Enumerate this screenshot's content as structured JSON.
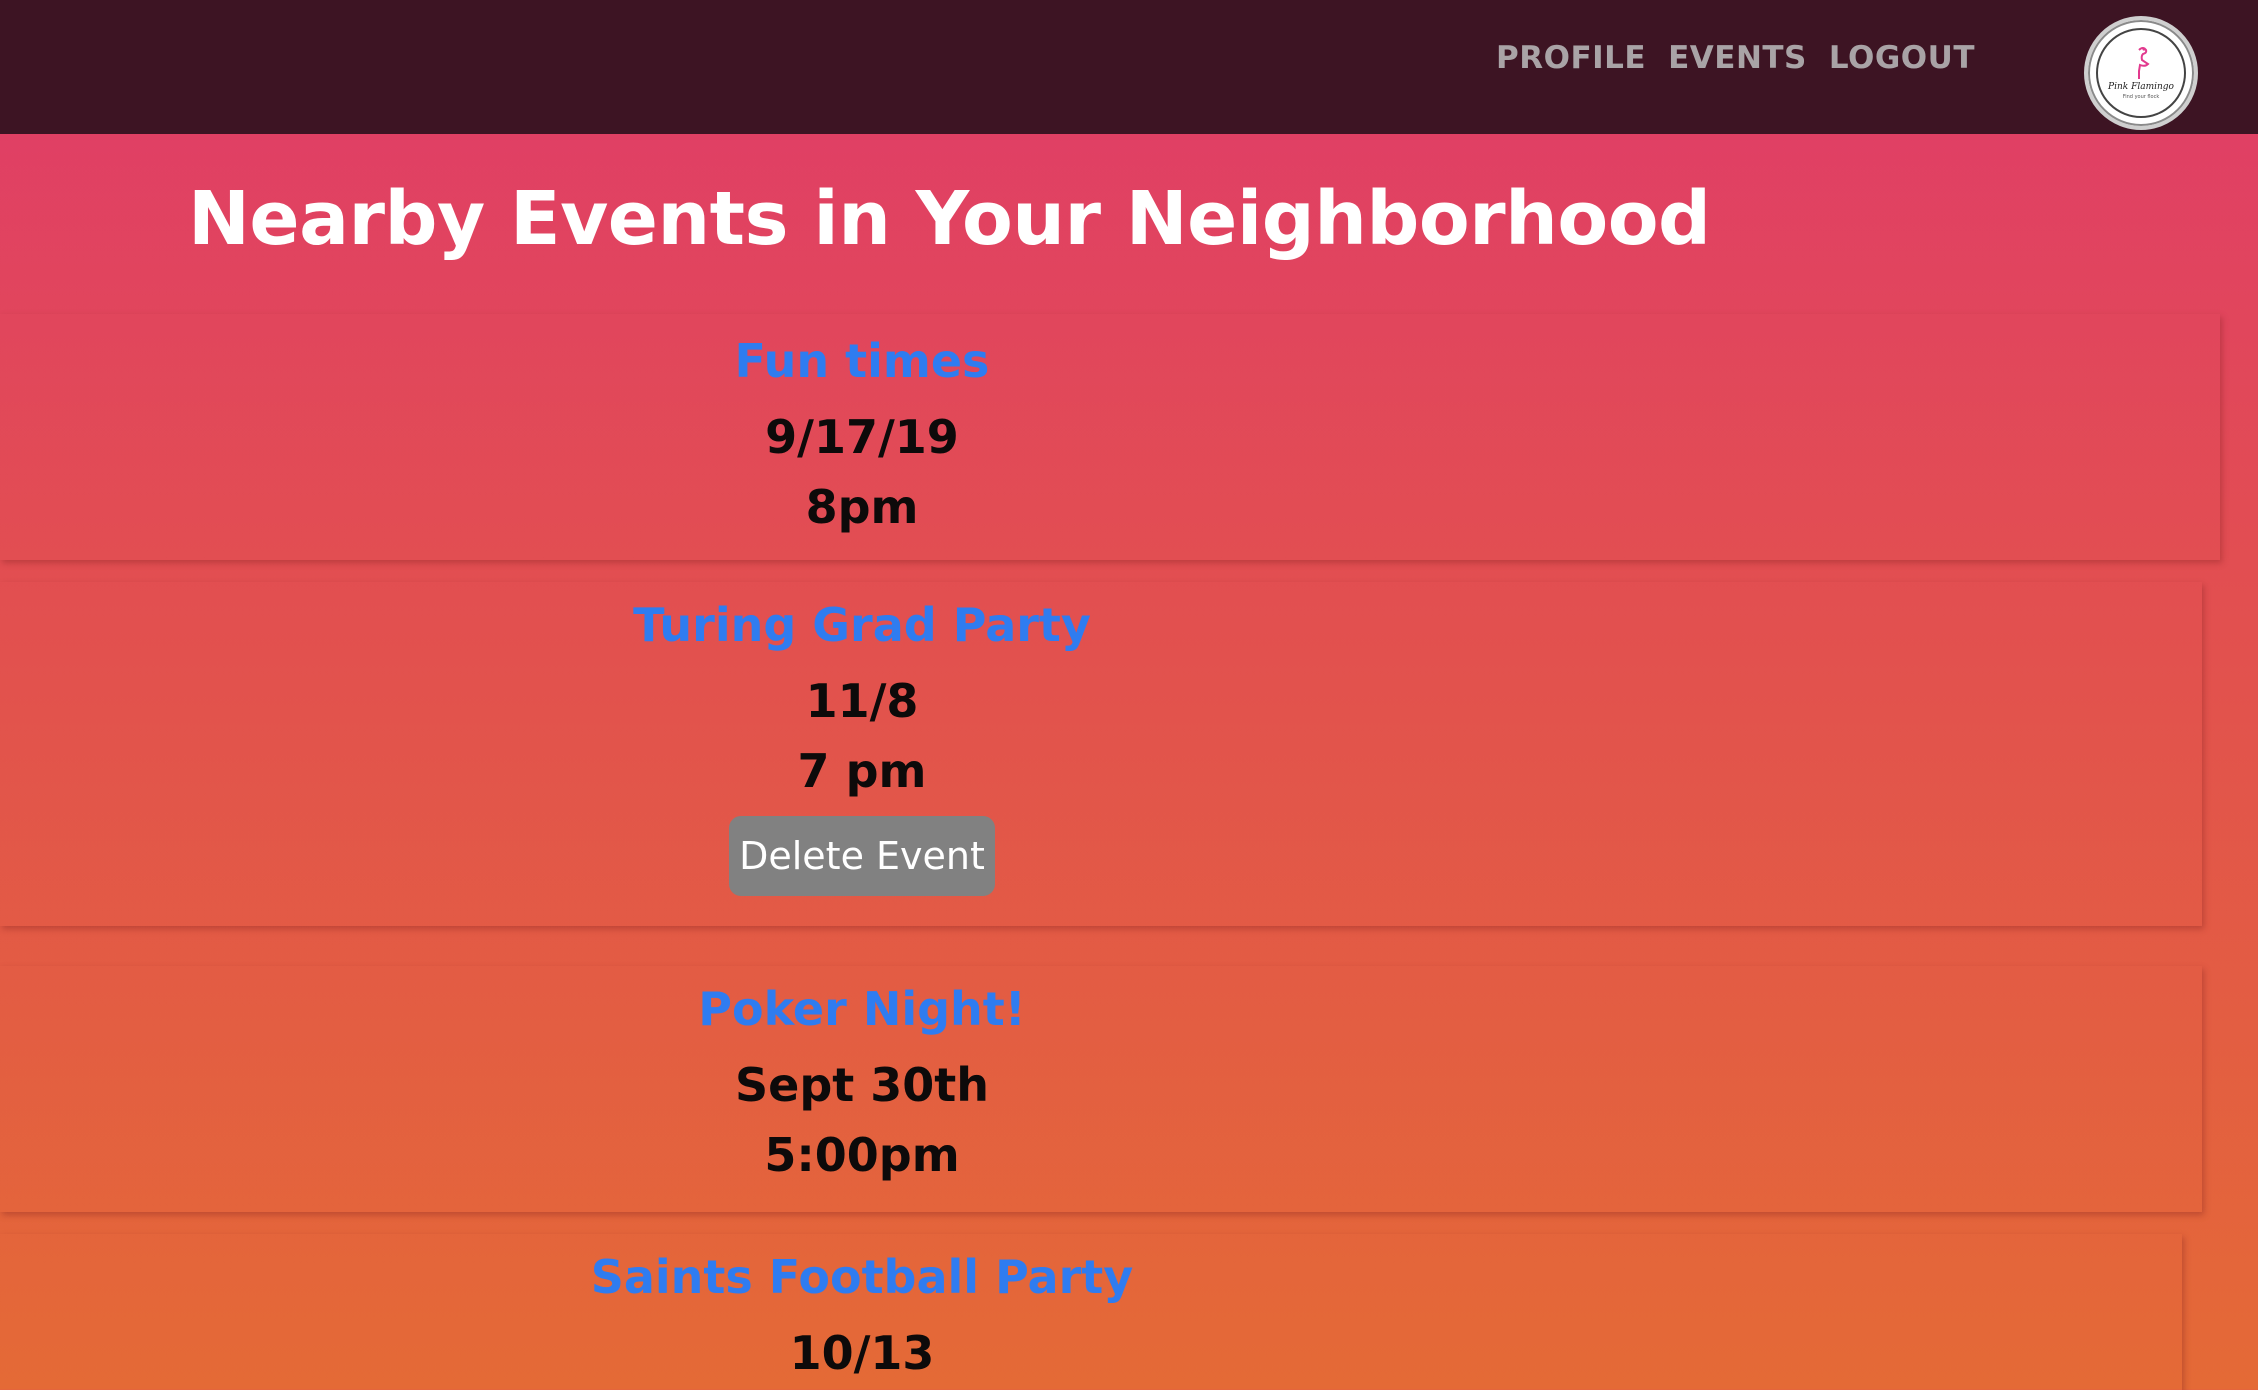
{
  "nav": {
    "profile": "PROFILE",
    "events": "EVENTS",
    "logout": "LOGOUT"
  },
  "logo": {
    "text": "Pink Flamingo",
    "subtext": "Find your flock"
  },
  "page": {
    "title": "Nearby Events in Your Neighborhood"
  },
  "events": [
    {
      "title": "Fun times",
      "date": "9/17/19",
      "time": "8pm"
    },
    {
      "title": "Turing Grad Party",
      "date": "11/8",
      "time": "7 pm",
      "action": "Delete Event"
    },
    {
      "title": "Poker Night!",
      "date": "Sept 30th",
      "time": "5:00pm"
    },
    {
      "title": "Saints Football Party",
      "date": "10/13"
    }
  ],
  "colors": {
    "topbar": "#3d1423",
    "event_title": "#2f7cf0",
    "delete_button": "#818181"
  }
}
